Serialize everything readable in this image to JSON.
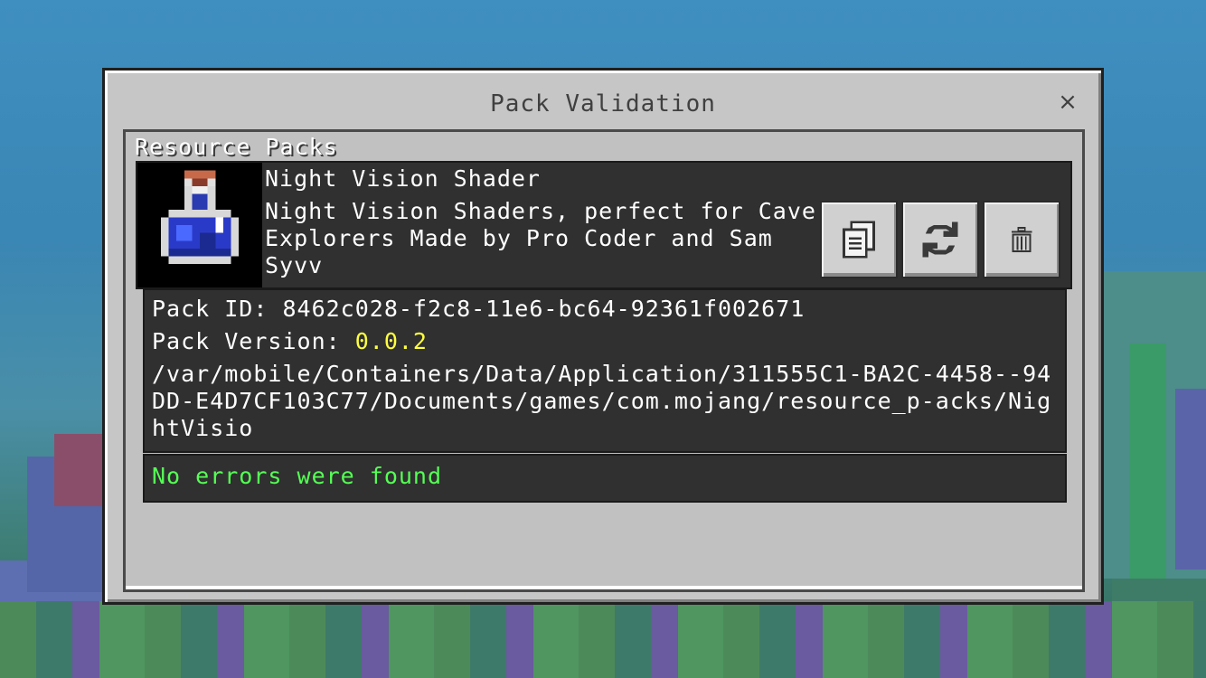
{
  "dialog": {
    "title": "Pack Validation",
    "close_label": "×"
  },
  "section": {
    "header": "Resource Packs"
  },
  "pack": {
    "title": "Night Vision Shader",
    "description": "Night Vision Shaders, perfect for Cave Explorers Made by Pro Coder and Sam Syvv",
    "icon": "potion-bottle-icon",
    "actions": [
      {
        "name": "copy-button",
        "icon": "copy-icon"
      },
      {
        "name": "refresh-button",
        "icon": "refresh-icon"
      },
      {
        "name": "delete-button",
        "icon": "trash-icon"
      }
    ]
  },
  "details": {
    "id_label": "Pack ID: ",
    "id_value": "8462c028-f2c8-11e6-bc64-92361f002671",
    "version_label": "Pack Version: ",
    "version_value": "0.0.2",
    "path": "/var/mobile/Containers/Data/Application/311555C1-BA2C-4458--94DD-E4D7CF103C77/Documents/games/com.mojang/resource_p-acks/NightVisio"
  },
  "status": {
    "message": "No errors were found"
  },
  "colors": {
    "version_accent": "#ffff40",
    "status_ok": "#55ff55",
    "panel_dark": "#303030",
    "dialog_bg": "#c6c6c6"
  }
}
